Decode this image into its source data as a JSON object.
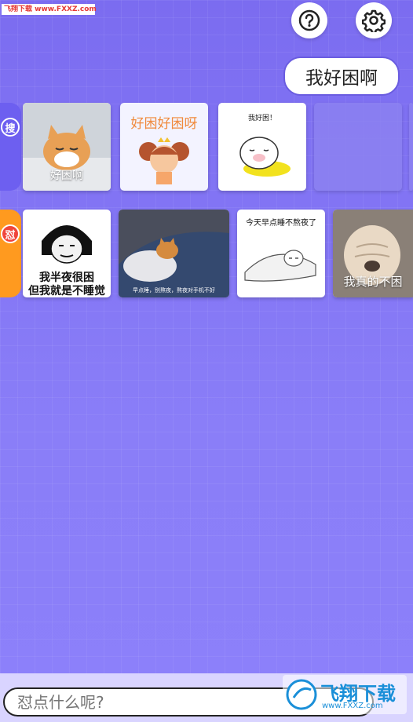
{
  "watermark": {
    "text": "飞翔下载 www.FXXZ.com"
  },
  "header": {
    "help_icon": "question-icon",
    "settings_icon": "gear-icon"
  },
  "bubble": {
    "text": "我好困啊"
  },
  "row1": {
    "tag": "搜",
    "tag_color": "#6d5ff0",
    "cards": [
      {
        "caption": "好困啊"
      },
      {
        "caption": "好困好困呀"
      },
      {
        "caption": "我好困！"
      }
    ]
  },
  "row2": {
    "tag": "怼",
    "tag_color": "#ff9a1f",
    "cards": [
      {
        "line1": "我半夜很困",
        "line2": "但我就是不睡觉"
      },
      {
        "caption": "早点睡，别熬夜，熬夜对手机不好"
      },
      {
        "caption": "今天早点睡不熬夜了"
      },
      {
        "caption": "我真的不困"
      }
    ]
  },
  "search": {
    "placeholder": "怼点什么呢?"
  },
  "logo": {
    "text": "飞翔下载",
    "url": "www.FXXZ.com"
  }
}
